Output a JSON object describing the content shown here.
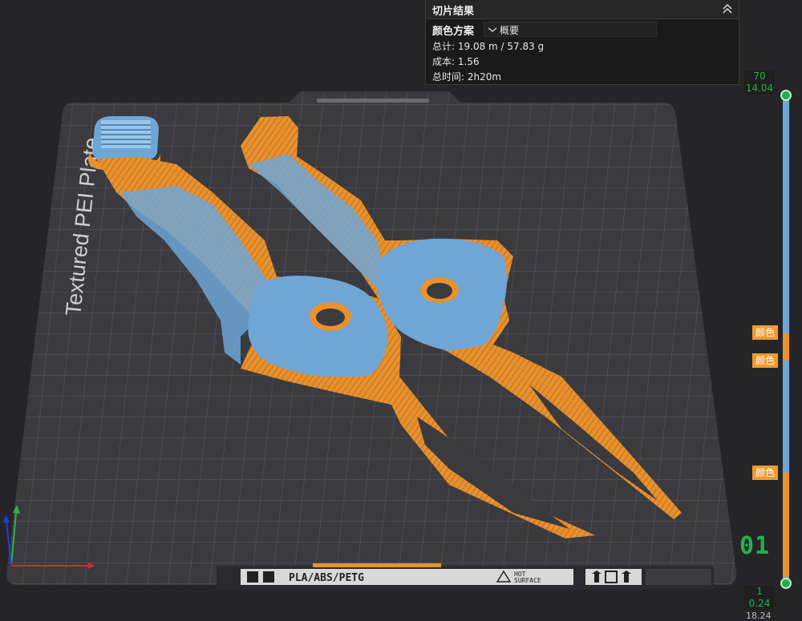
{
  "slice_panel": {
    "title": "切片结果",
    "color_scheme_label": "颜色方案",
    "color_scheme_value": "概要",
    "total": "总计: 19.08 m / 57.83 g",
    "cost": "成本: 1.56",
    "total_time": "总时间: 2h20m"
  },
  "plate": {
    "label": "Textured PEI Plate",
    "filament_text": "PLA/ABS/PETG",
    "hot_surface_text_1": "HOT",
    "hot_surface_text_2": "SURFACE"
  },
  "layer_slider": {
    "top_layer": "70",
    "top_height": "14.04",
    "bottom_layer": "1",
    "bottom_height": "0.24",
    "color_tag_1": "颜色",
    "color_tag_2": "颜色",
    "color_tag_3": "颜色",
    "current_big": "01",
    "corner_readout": "18.24"
  },
  "colors": {
    "orange": "#e8922f",
    "blue": "#6fa6d6",
    "green": "#22b24c",
    "plate": "#3a3a3f"
  }
}
